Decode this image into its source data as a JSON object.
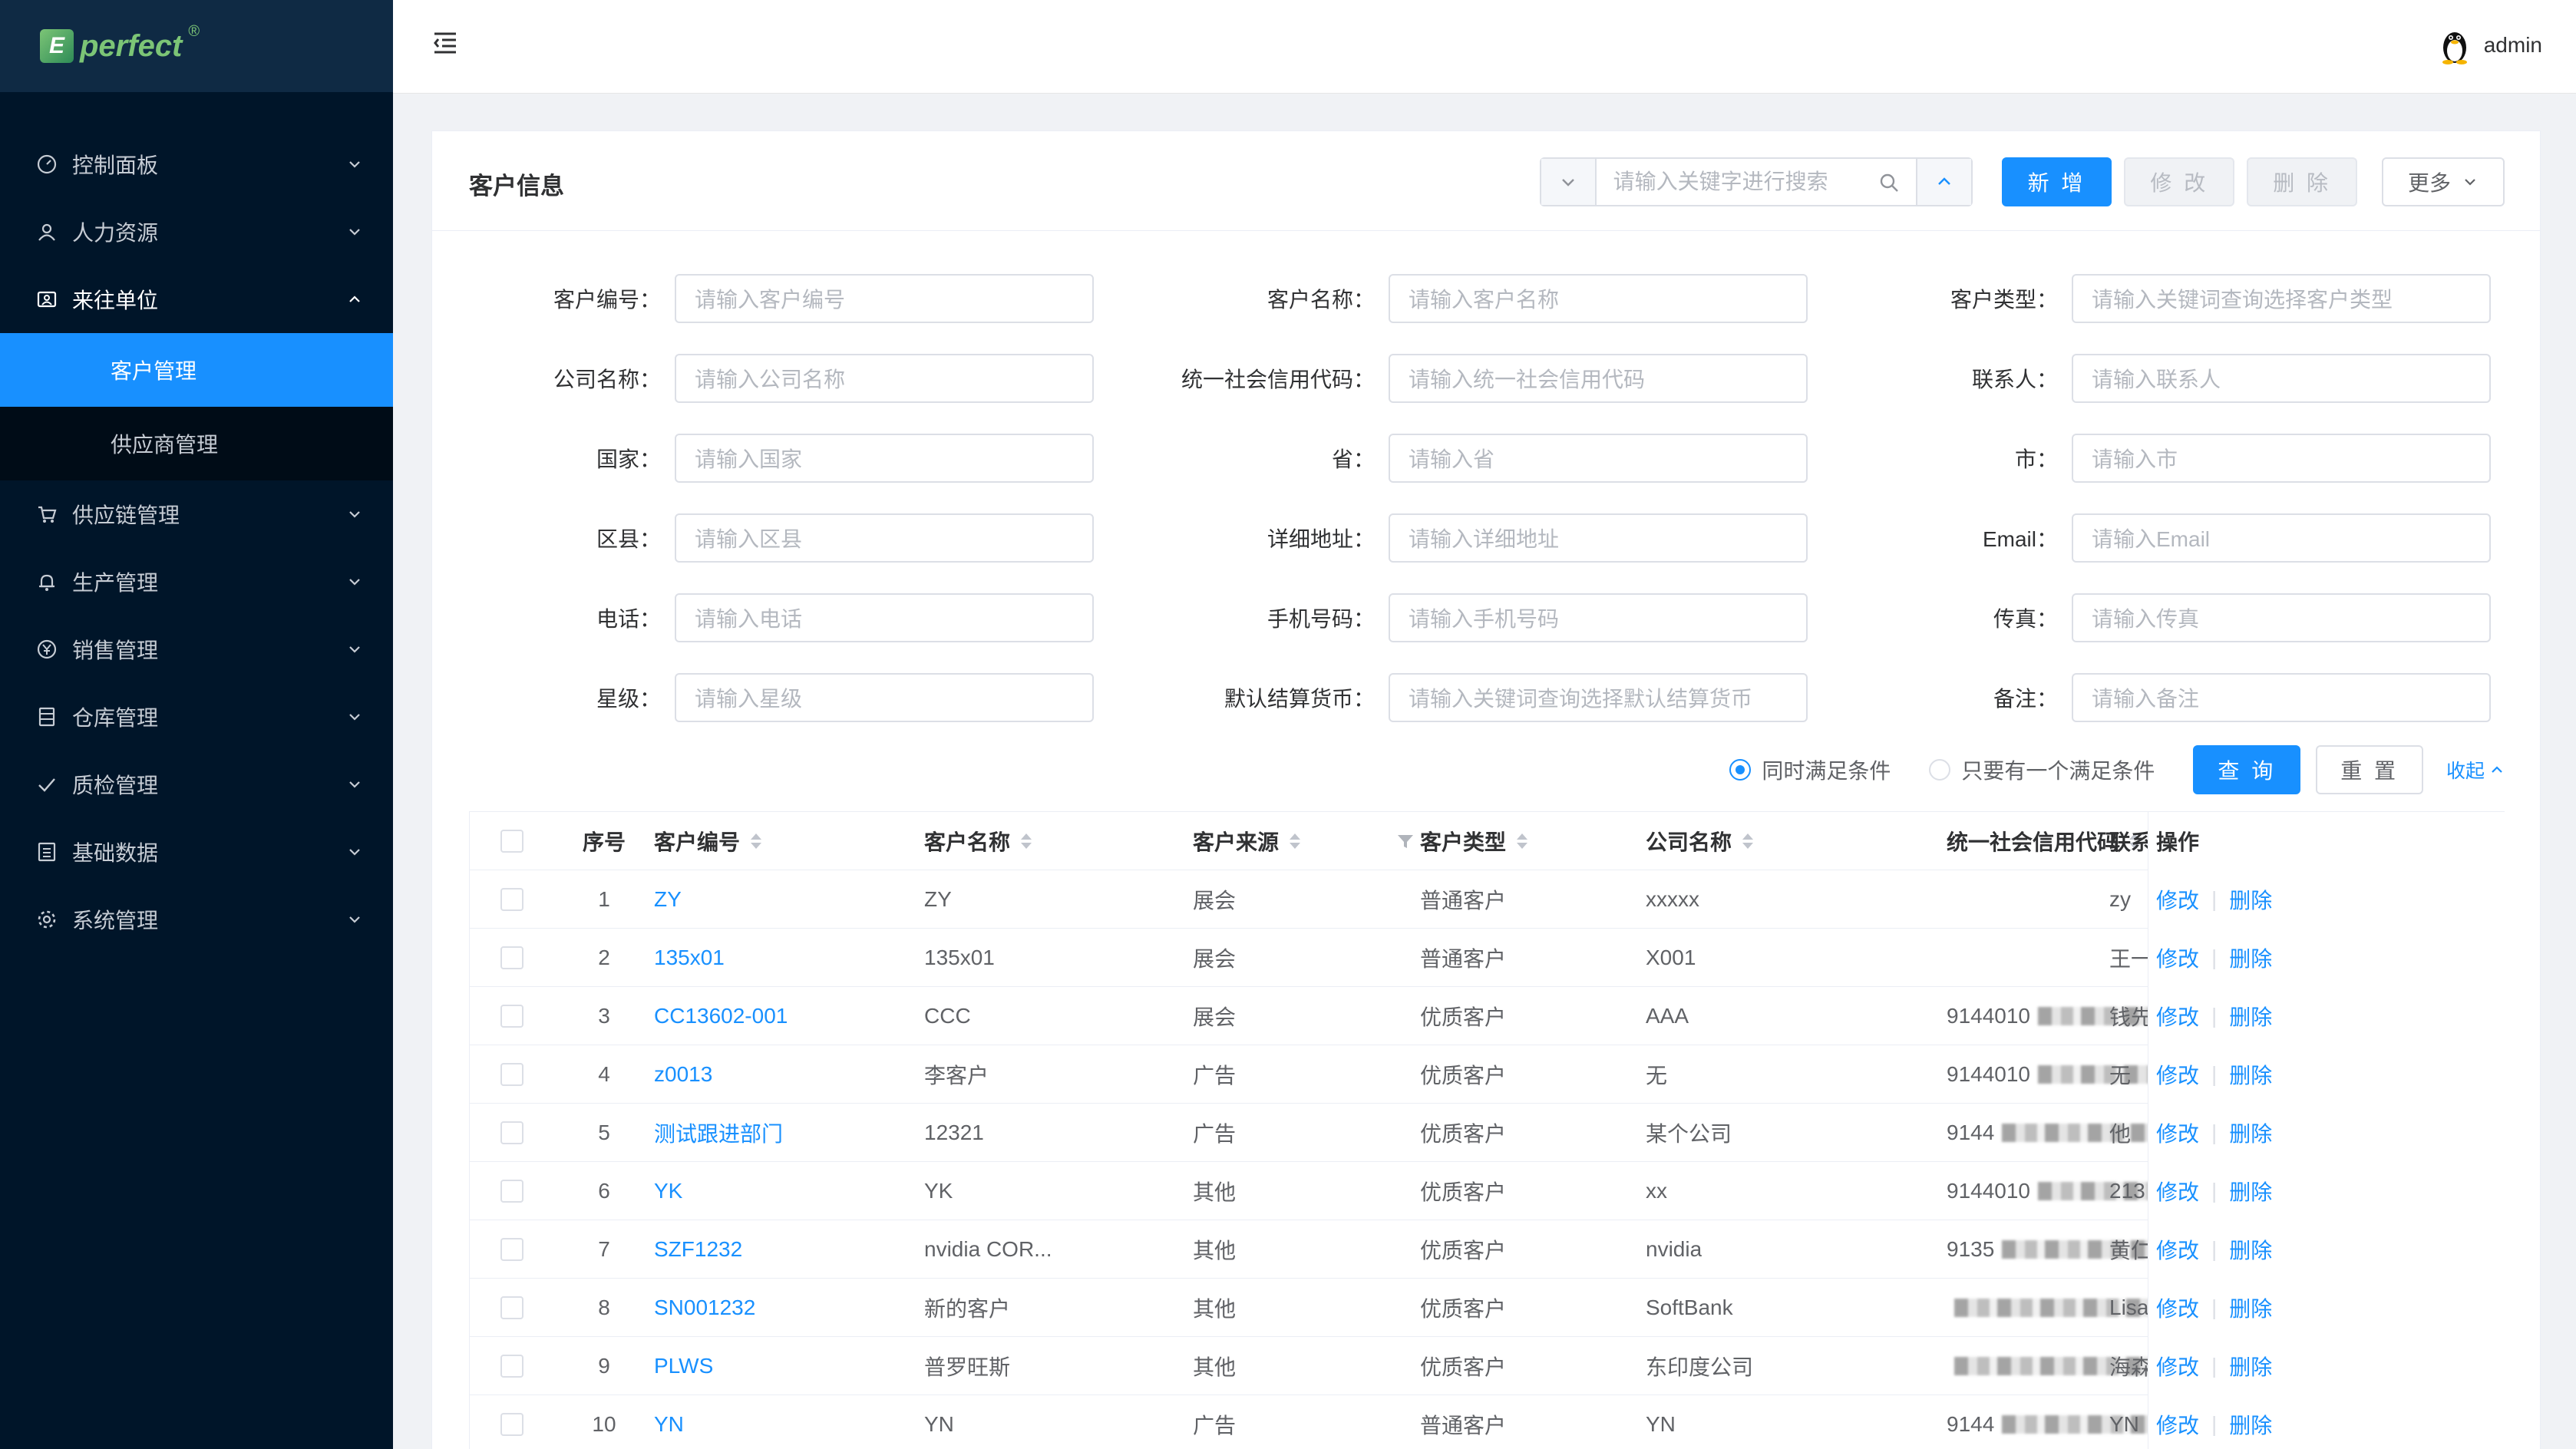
{
  "brand": {
    "logo_letter": "E",
    "name": "perfect",
    "reg": "®"
  },
  "sidebar": {
    "items": [
      {
        "label": "控制面板",
        "icon": "dashboard-icon"
      },
      {
        "label": "人力资源",
        "icon": "user-icon"
      },
      {
        "label": "来往单位",
        "icon": "contacts-icon",
        "open": true
      },
      {
        "label": "供应链管理",
        "icon": "cart-icon"
      },
      {
        "label": "生产管理",
        "icon": "bell-icon"
      },
      {
        "label": "销售管理",
        "icon": "yen-icon"
      },
      {
        "label": "仓库管理",
        "icon": "warehouse-icon"
      },
      {
        "label": "质检管理",
        "icon": "check-icon"
      },
      {
        "label": "基础数据",
        "icon": "list-icon"
      },
      {
        "label": "系统管理",
        "icon": "gear-icon"
      }
    ],
    "subitems": [
      {
        "label": "客户管理",
        "active": true
      },
      {
        "label": "供应商管理",
        "active": false
      }
    ]
  },
  "header": {
    "username": "admin"
  },
  "card": {
    "title": "客户信息",
    "search_placeholder": "请输入关键字进行搜索",
    "btn_add": "新 增",
    "btn_edit": "修 改",
    "btn_delete": "删 除",
    "btn_more": "更多"
  },
  "form": [
    {
      "label": "客户编号：",
      "placeholder": "请输入客户编号"
    },
    {
      "label": "客户名称：",
      "placeholder": "请输入客户名称"
    },
    {
      "label": "客户类型：",
      "placeholder": "请输入关键词查询选择客户类型"
    },
    {
      "label": "公司名称：",
      "placeholder": "请输入公司名称"
    },
    {
      "label": "统一社会信用代码：",
      "placeholder": "请输入统一社会信用代码"
    },
    {
      "label": "联系人：",
      "placeholder": "请输入联系人"
    },
    {
      "label": "国家：",
      "placeholder": "请输入国家"
    },
    {
      "label": "省：",
      "placeholder": "请输入省"
    },
    {
      "label": "市：",
      "placeholder": "请输入市"
    },
    {
      "label": "区县：",
      "placeholder": "请输入区县"
    },
    {
      "label": "详细地址：",
      "placeholder": "请输入详细地址"
    },
    {
      "label": "Email：",
      "placeholder": "请输入Email"
    },
    {
      "label": "电话：",
      "placeholder": "请输入电话"
    },
    {
      "label": "手机号码：",
      "placeholder": "请输入手机号码"
    },
    {
      "label": "传真：",
      "placeholder": "请输入传真"
    },
    {
      "label": "星级：",
      "placeholder": "请输入星级"
    },
    {
      "label": "默认结算货币：",
      "placeholder": "请输入关键词查询选择默认结算货币"
    },
    {
      "label": "备注：",
      "placeholder": "请输入备注"
    }
  ],
  "conditions": {
    "all": "同时满足条件",
    "any": "只要有一个满足条件",
    "query": "查 询",
    "reset": "重 置",
    "collapse": "收起"
  },
  "table": {
    "headers": {
      "index": "序号",
      "code": "客户编号",
      "name": "客户名称",
      "source": "客户来源",
      "type": "客户类型",
      "company": "公司名称",
      "credit": "统一社会信用代码",
      "contact": "联系",
      "ops": "操作"
    },
    "op_edit": "修改",
    "op_delete": "删除",
    "rows": [
      {
        "index": "1",
        "code": "ZY",
        "name": "ZY",
        "source": "展会",
        "type": "普通客户",
        "company": "xxxxx",
        "credit": "",
        "contact": "zy"
      },
      {
        "index": "2",
        "code": "135x01",
        "name": "135x01",
        "source": "展会",
        "type": "普通客户",
        "company": "X001",
        "credit": "",
        "contact": "王一"
      },
      {
        "index": "3",
        "code": "CC13602-001",
        "name": "CCC",
        "source": "展会",
        "type": "优质客户",
        "company": "AAA",
        "credit": "9144010",
        "contact": "钱先"
      },
      {
        "index": "4",
        "code": "z0013",
        "name": "李客户",
        "source": "广告",
        "type": "优质客户",
        "company": "无",
        "credit": "9144010",
        "contact": "无"
      },
      {
        "index": "5",
        "code": "测试跟进部门",
        "name": "12321",
        "source": "广告",
        "type": "优质客户",
        "company": "某个公司",
        "credit": "9144",
        "contact": "他"
      },
      {
        "index": "6",
        "code": "YK",
        "name": "YK",
        "source": "其他",
        "type": "优质客户",
        "company": "xx",
        "credit": "9144010",
        "contact": "213"
      },
      {
        "index": "7",
        "code": "SZF1232",
        "name": "nvidia COR...",
        "source": "其他",
        "type": "优质客户",
        "company": "nvidia",
        "credit": "9135",
        "contact": "黄仁"
      },
      {
        "index": "8",
        "code": "SN001232",
        "name": "新的客户",
        "source": "其他",
        "type": "优质客户",
        "company": "SoftBank",
        "credit": "",
        "contact": "Lisa"
      },
      {
        "index": "9",
        "code": "PLWS",
        "name": "普罗旺斯",
        "source": "其他",
        "type": "优质客户",
        "company": "东印度公司",
        "credit": "",
        "contact": "海森"
      },
      {
        "index": "10",
        "code": "YN",
        "name": "YN",
        "source": "广告",
        "type": "普通客户",
        "company": "YN",
        "credit": "9144",
        "contact": "YN"
      }
    ]
  }
}
